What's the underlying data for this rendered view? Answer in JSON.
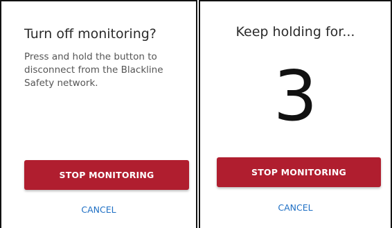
{
  "left_screen": {
    "title": "Turn off monitoring?",
    "body": "Press and hold the button to disconnect from the Blackline Safety network.",
    "stop_button_label": "STOP MONITORING",
    "cancel_label": "CANCEL"
  },
  "right_screen": {
    "title": "Keep holding for...",
    "countdown": "3",
    "stop_button_label": "STOP MONITORING",
    "cancel_label": "CANCEL"
  },
  "colors": {
    "stop_button": "#b01e2f",
    "cancel_link": "#1e6fc4",
    "border": "#111111"
  }
}
